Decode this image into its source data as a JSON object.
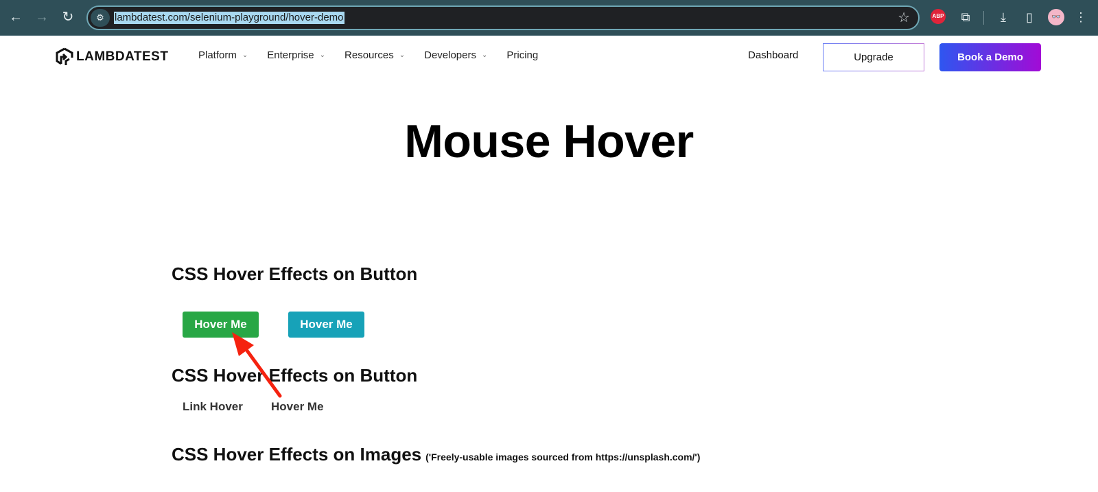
{
  "browser": {
    "url": "lambdatest.com/selenium-playground/hover-demo",
    "back_icon": "←",
    "forward_icon": "→",
    "reload_icon": "↻",
    "site_info_icon": "⚙",
    "bookmark_icon": "☆",
    "extensions": {
      "abp_label": "ABP",
      "puzzle_icon": "⧉",
      "download_icon": "⤓",
      "sidepanel_icon": "▯",
      "avatar_icon": "👓",
      "menu_icon": "⋮"
    }
  },
  "header": {
    "logo_text": "LAMBDATEST",
    "nav": [
      {
        "label": "Platform",
        "has_dropdown": true
      },
      {
        "label": "Enterprise",
        "has_dropdown": true
      },
      {
        "label": "Resources",
        "has_dropdown": true
      },
      {
        "label": "Developers",
        "has_dropdown": true
      },
      {
        "label": "Pricing",
        "has_dropdown": false
      }
    ],
    "chevron": "⌄",
    "dashboard_label": "Dashboard",
    "upgrade_label": "Upgrade",
    "demo_label": "Book a Demo"
  },
  "main": {
    "title": "Mouse Hover",
    "sections": [
      {
        "title": "CSS Hover Effects on Button",
        "buttons": [
          "Hover Me",
          "Hover Me"
        ]
      },
      {
        "title": "CSS Hover Effects on Button",
        "links": [
          "Link Hover",
          "Hover Me"
        ]
      },
      {
        "title": "CSS Hover Effects on Images",
        "note": "('Freely-usable images sourced from https://unsplash.com/')"
      }
    ]
  },
  "colors": {
    "green_button": "#28a745",
    "teal_button": "#17a2b8",
    "annotation_arrow": "#f5220f",
    "demo_gradient_start": "#2e56f0",
    "demo_gradient_end": "#a20bd6"
  }
}
